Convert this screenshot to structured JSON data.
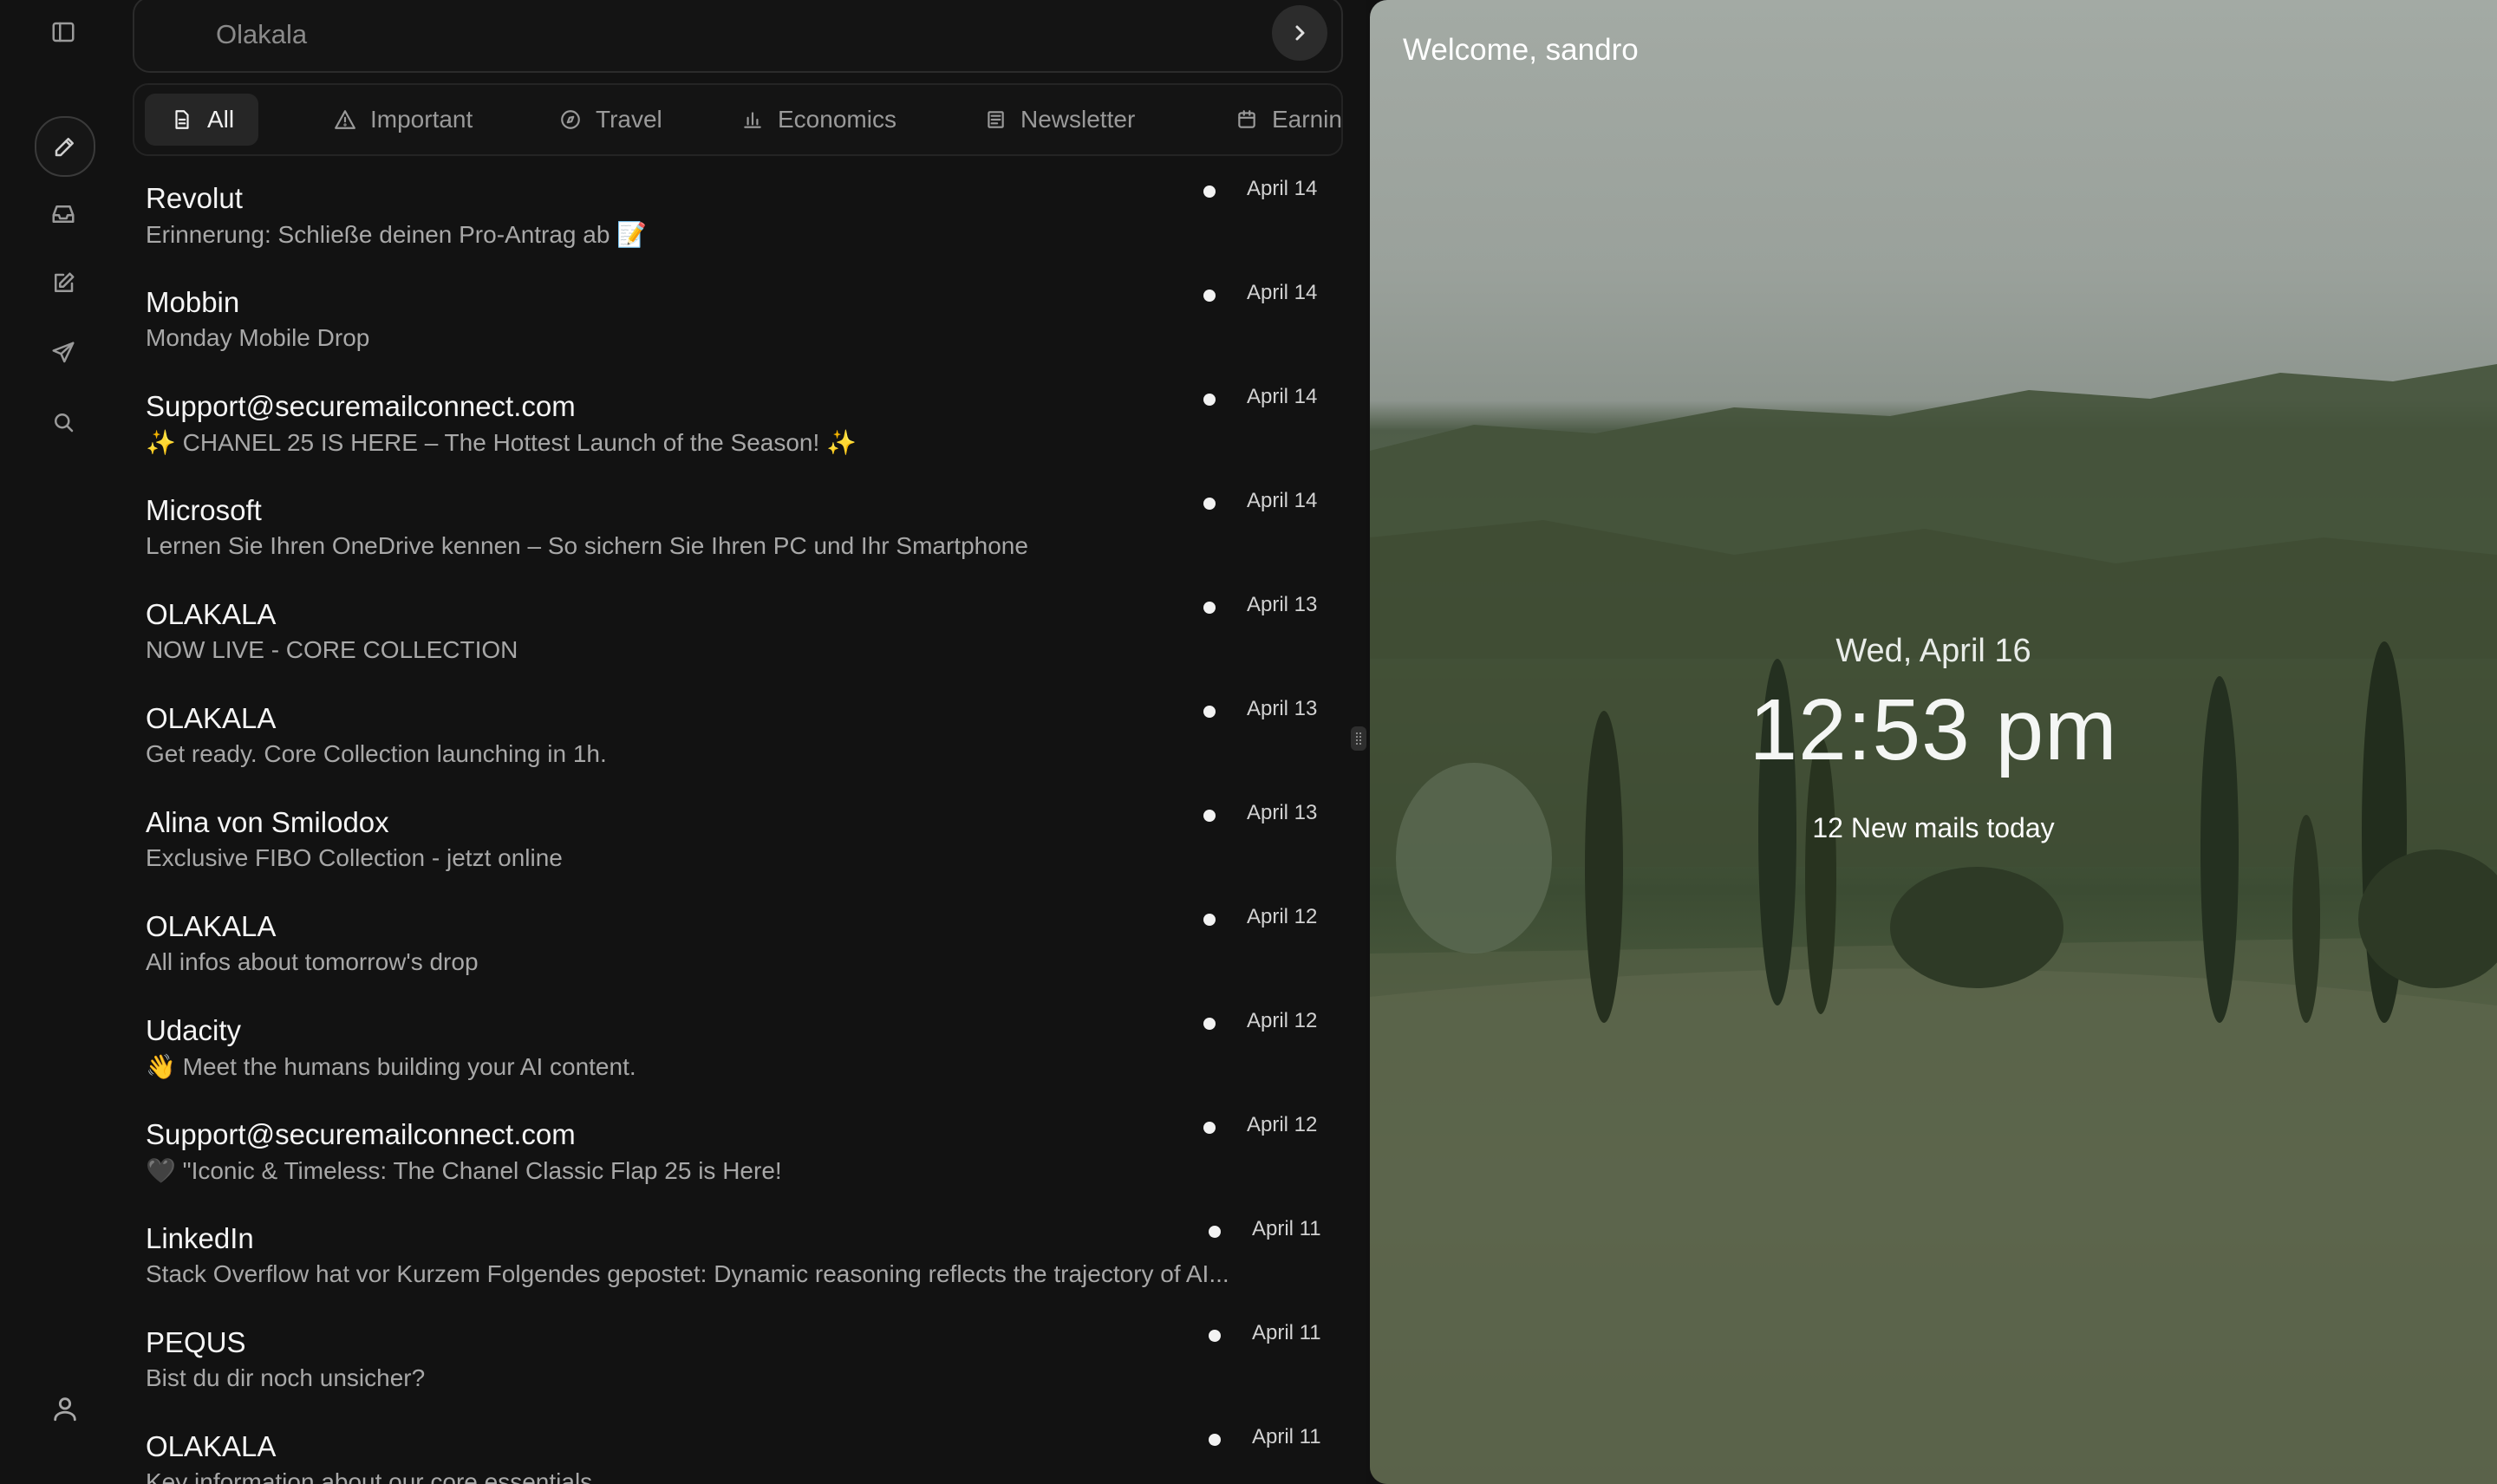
{
  "search": {
    "value": "",
    "placeholder": "Olakala"
  },
  "tabs": [
    {
      "label": "All",
      "icon": "file-text-icon"
    },
    {
      "label": "Important",
      "icon": "alert-triangle-icon"
    },
    {
      "label": "Travel",
      "icon": "compass-icon"
    },
    {
      "label": "Economics",
      "icon": "bar-chart-icon"
    },
    {
      "label": "Newsletter",
      "icon": "newspaper-icon"
    },
    {
      "label": "Earning",
      "icon": "calendar-icon"
    }
  ],
  "mails": [
    {
      "sender": "Revolut",
      "subject": "Erinnerung: Schließe deinen Pro-Antrag ab 📝",
      "date": "April 14"
    },
    {
      "sender": "Mobbin",
      "subject": "Monday Mobile Drop",
      "date": "April 14"
    },
    {
      "sender": "Support@securemailconnect.com",
      "subject": "✨ CHANEL 25 IS HERE – The Hottest Launch of the Season! ✨",
      "date": "April 14"
    },
    {
      "sender": "Microsoft",
      "subject": "Lernen Sie Ihren OneDrive kennen – So sichern Sie Ihren PC und Ihr Smartphone",
      "date": "April 14"
    },
    {
      "sender": "OLAKALA",
      "subject": "NOW LIVE - CORE COLLECTION",
      "date": "April 13"
    },
    {
      "sender": "OLAKALA",
      "subject": "Get ready. Core Collection launching in 1h.",
      "date": "April 13"
    },
    {
      "sender": "Alina von Smilodox",
      "subject": "Exclusive FIBO Collection - jetzt online",
      "date": "April 13"
    },
    {
      "sender": "OLAKALA",
      "subject": "All infos about tomorrow's drop",
      "date": "April 12"
    },
    {
      "sender": "Udacity",
      "subject": "👋 Meet the humans building your AI content.",
      "date": "April 12"
    },
    {
      "sender": "Support@securemailconnect.com",
      "subject": "🖤 \"Iconic & Timeless: The Chanel Classic Flap 25 is Here!",
      "date": "April 12"
    },
    {
      "sender": "LinkedIn",
      "subject": "Stack Overflow hat vor Kurzem Folgendes gepostet: Dynamic reasoning reflects the trajectory of AI...",
      "date": "April 11"
    },
    {
      "sender": "PEQUS",
      "subject": "Bist du dir noch unsicher?",
      "date": "April 11"
    },
    {
      "sender": "OLAKALA",
      "subject": "Key information about our core essentials",
      "date": "April 11"
    }
  ],
  "hero": {
    "welcome": "Welcome, sandro",
    "date": "Wed, April 16",
    "time": "12:53 pm",
    "count": "12 New mails today"
  }
}
